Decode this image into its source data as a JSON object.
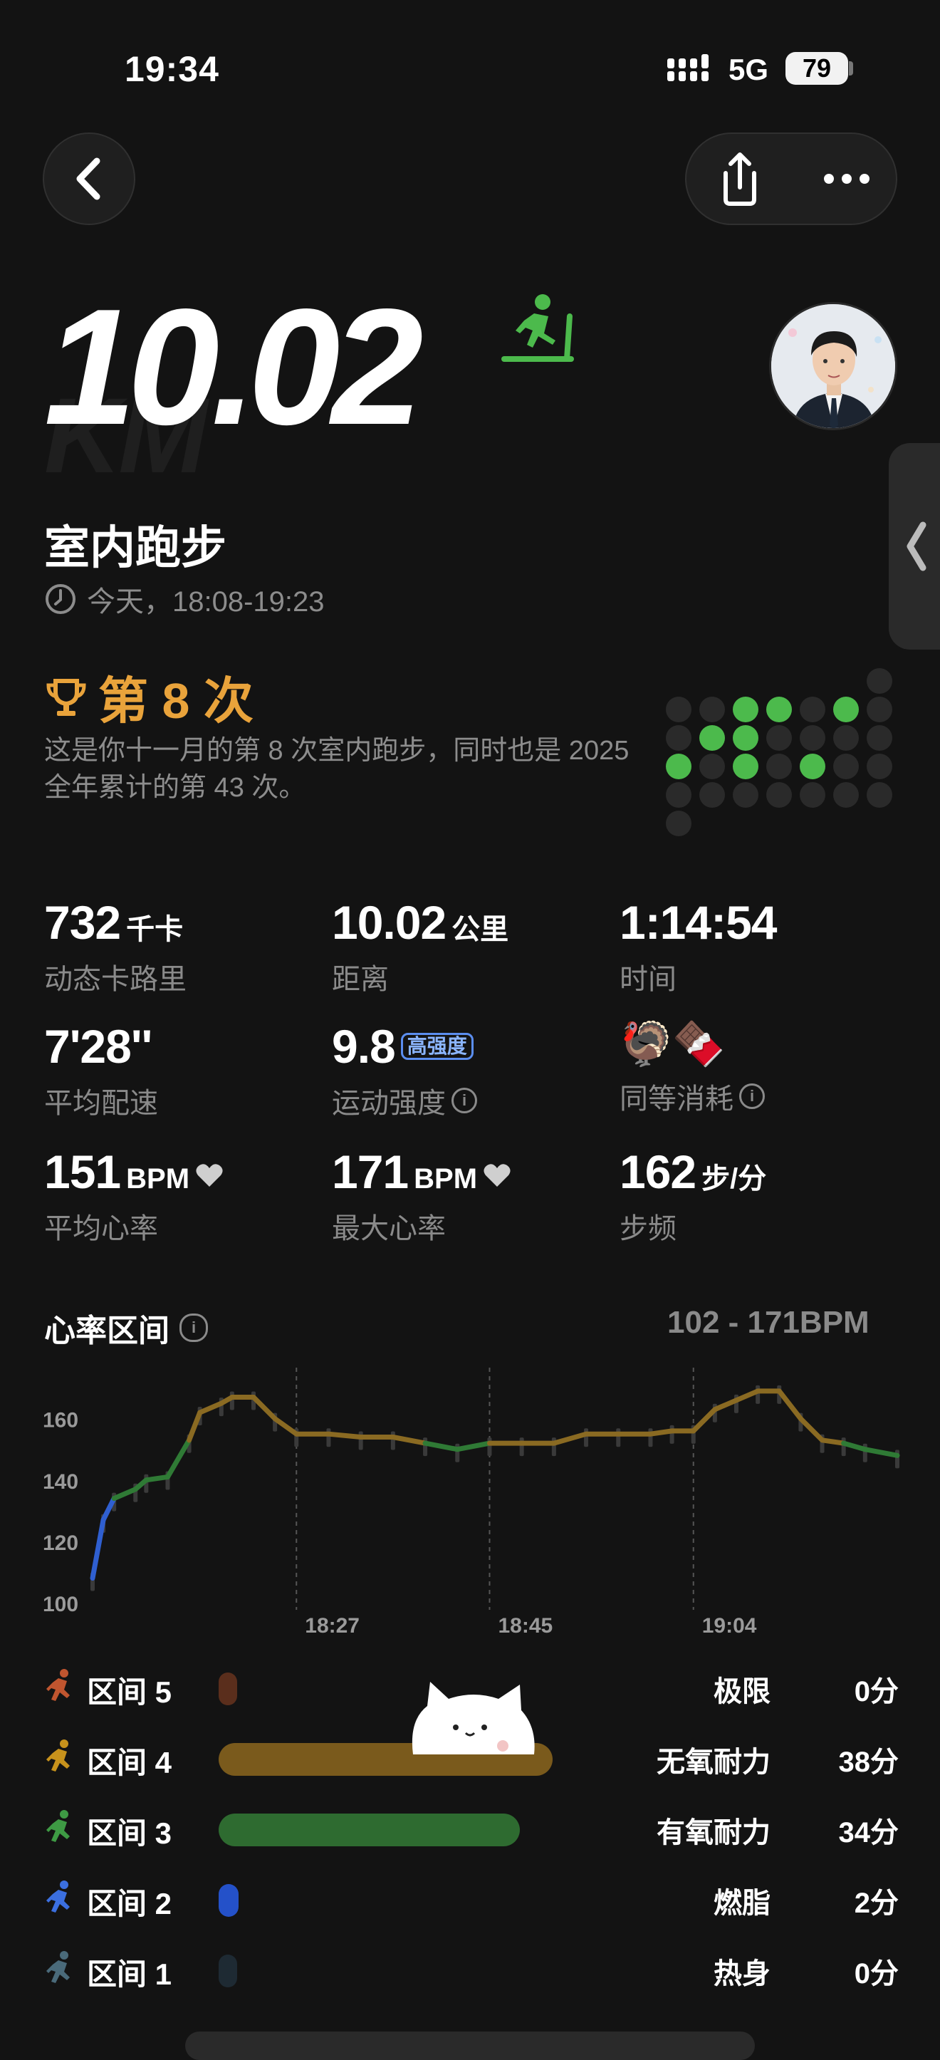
{
  "status": {
    "time": "19:34",
    "network": "5G",
    "battery": "79"
  },
  "nav": {
    "back_icon": "chevron-left-icon",
    "share_icon": "share-icon",
    "more_icon": "more-icon"
  },
  "workout": {
    "distance": "10.02",
    "distance_ghost": "KM",
    "activity_icon": "treadmill-runner-icon",
    "title": "室内跑步",
    "time_range": "今天，18:08-19:23",
    "rank": "第 8 次",
    "rank_desc": "这是你十一月的第 8 次室内跑步，同时也是 2025 全年累计的第 43 次。"
  },
  "colors": {
    "accent_green": "#4cba4c",
    "rank_gold": "#e9a33b",
    "zone5": "#5a2e1c",
    "zone4": "#7a5a1c",
    "zone3": "#2e6b30",
    "zone2": "#2451c9",
    "zone1": "#1e2a33"
  },
  "stats": [
    {
      "value": "732",
      "unit": "千卡",
      "label": "动态卡路里"
    },
    {
      "value": "10.02",
      "unit": "公里",
      "label": "距离"
    },
    {
      "value": "1:14:54",
      "unit": "",
      "label": "时间"
    },
    {
      "value": "7'28''",
      "unit": "",
      "label": "平均配速"
    },
    {
      "value": "9.8",
      "badge": "高强度",
      "label": "运动强度"
    },
    {
      "value": "🦃🍫",
      "unit": "",
      "label": "同等消耗"
    },
    {
      "value": "151",
      "unit": "BPM",
      "label": "平均心率"
    },
    {
      "value": "171",
      "unit": "BPM",
      "label": "最大心率"
    },
    {
      "value": "162",
      "unit": "步/分",
      "label": "步频"
    }
  ],
  "heart_rate": {
    "title": "心率区间",
    "range": "102 - 171BPM"
  },
  "chart_data": {
    "type": "line",
    "y_ticks": [
      "160",
      "140",
      "120",
      "100"
    ],
    "x_ticks": [
      "18:27",
      "18:45",
      "19:04"
    ],
    "ylim": [
      100,
      172
    ],
    "series": [
      {
        "x": [
          "18:08",
          "18:09",
          "18:10",
          "18:12",
          "18:13",
          "18:15",
          "18:17",
          "18:18",
          "18:20",
          "18:21",
          "18:23",
          "18:25",
          "18:27",
          "18:30",
          "18:33",
          "18:36",
          "18:39",
          "18:42",
          "18:45",
          "18:48",
          "18:51",
          "18:54",
          "18:57",
          "19:00",
          "19:02",
          "19:04",
          "19:06",
          "19:08",
          "19:10",
          "19:12",
          "19:14",
          "19:16",
          "19:18",
          "19:20",
          "19:23"
        ],
        "values": [
          108,
          127,
          134,
          137,
          140,
          141,
          153,
          162,
          165,
          167,
          167,
          160,
          155,
          155,
          154,
          154,
          152,
          150,
          152,
          152,
          152,
          155,
          155,
          155,
          156,
          156,
          163,
          166,
          169,
          169,
          160,
          153,
          152,
          150,
          148
        ]
      }
    ]
  },
  "zones": [
    {
      "name": "区间 5",
      "label": "极限",
      "minutes": "0分",
      "pct": 0.0
    },
    {
      "name": "区间 4",
      "label": "无氧耐力",
      "minutes": "38分",
      "pct": 0.51
    },
    {
      "name": "区间 3",
      "label": "有氧耐力",
      "minutes": "34分",
      "pct": 0.46
    },
    {
      "name": "区间 2",
      "label": "燃脂",
      "minutes": "2分",
      "pct": 0.03
    },
    {
      "name": "区间 1",
      "label": "热身",
      "minutes": "0分",
      "pct": 0.0
    }
  ]
}
